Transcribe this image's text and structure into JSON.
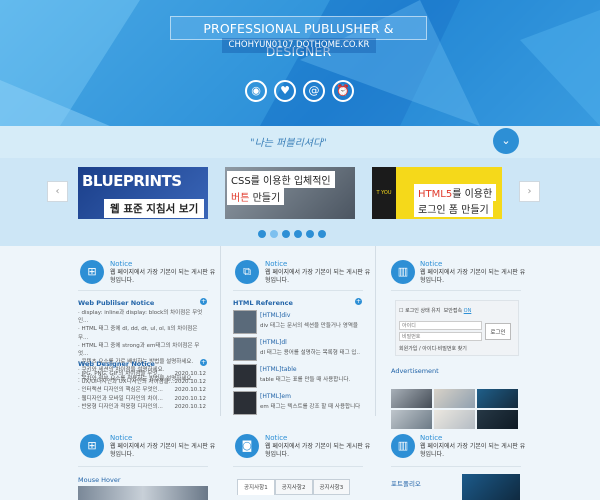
{
  "hero": {
    "title": "PROFESSIONAL PUBLUSHER & DESIGNER",
    "url": "CHOHYUN0107.DOTHOME.CO.KR",
    "icons": [
      "record-icon",
      "heart-icon",
      "at-icon",
      "alarm-icon"
    ]
  },
  "quote": "\"나는 퍼블리셔다\"",
  "slides": [
    {
      "title": "BLUEPRINTS",
      "subtitle": "웹 표준 지침서 보기"
    },
    {
      "line1": "CSS를 이용한 입체적인",
      "line2_red": "버튼",
      "line2": " 만들기"
    },
    {
      "side": "T YOU GET",
      "line1_red": "HTML5",
      "line1": "를 이용한",
      "line2": "로그인 폼 만들기"
    }
  ],
  "slider_dots": 6,
  "col1": {
    "notice_title": "Notice",
    "notice_desc": "웹 페이지에서 가장 기본이 되는 게시판 유형입니다.",
    "publisher_title": "Web Publilser Notice",
    "publisher_items": [
      "· display: inline과 display: block의 차이점은 무엇인...",
      "· HTML 태그 중에 dl, dd, dt, ul, ol, li의 차이점은 무...",
      "· HTML 태그 중에 strong과 em태그의 차이점은 무엇...",
      "· 콘텐츠 요소를 가로 배치하는 방법을 설명하세요.",
      "· 쿠키와 세션의 차이점을 설명하세요.",
      "· 목차와 첨부 요소를 적용하는 방법을 설명하세요."
    ],
    "designer_title": "Web Designer Notice",
    "designer_items": [
      {
        "text": "· JPG, PNG, GIF의 차이점을 무엇...",
        "date": "2020.10.12"
      },
      {
        "text": "· UX/UI디자인과 UX디자인의 차이점을...",
        "date": "2020.10.12"
      },
      {
        "text": "· 인터랙션 디자인의 핵심은 무엇인...",
        "date": "2020.10.12"
      },
      {
        "text": "· 웹디자인과 모바일 디자인의 차이...",
        "date": "2020.10.12"
      },
      {
        "text": "· 반응형 디자인과 적응형 디자인의...",
        "date": "2020.10.12"
      }
    ]
  },
  "col2": {
    "notice_title": "Notice",
    "notice_desc": "웹 페이지에서 가장 기본이 되는 게시판 유형입니다.",
    "ref_title": "HTML Reference",
    "refs": [
      {
        "title": "[HTML]div",
        "desc": "div 태그는 문서의 섹션을 만들거나 영역을 ..."
      },
      {
        "title": "[HTML]dl",
        "desc": "dl 태그는 용어를 설명하는 목록형 태그 입..."
      },
      {
        "title": "[HTML]table",
        "desc": "table 태그는 표를 만들 때 사용합니다."
      },
      {
        "title": "[HTML]em",
        "desc": "em 태그는 텍스트를 강조 할 때 사용합니다."
      }
    ]
  },
  "col3": {
    "notice_title": "Notice",
    "notice_desc": "웹 페이지에서 가장 기본이 되는 게시판 유형입니다.",
    "login": {
      "remember": "로그인 상태 유지",
      "secure": "보안접속",
      "secure_state": "ON",
      "id_placeholder": "아이디",
      "pw_placeholder": "비밀번호",
      "button": "로그인",
      "links": "회원가입 / 아이디·비밀번호 찾기"
    },
    "ad_title": "Advertisement"
  },
  "row2": {
    "notice_title": "Notice",
    "notice_desc": "웹 페이지에서 가장 기본이 되는 게시판 유형입니다.",
    "mouse_hover": "Mouse Hover",
    "tabs": [
      "공지사항1",
      "공지사항2",
      "공지사항3"
    ],
    "portfolio": "포트폴리오"
  }
}
